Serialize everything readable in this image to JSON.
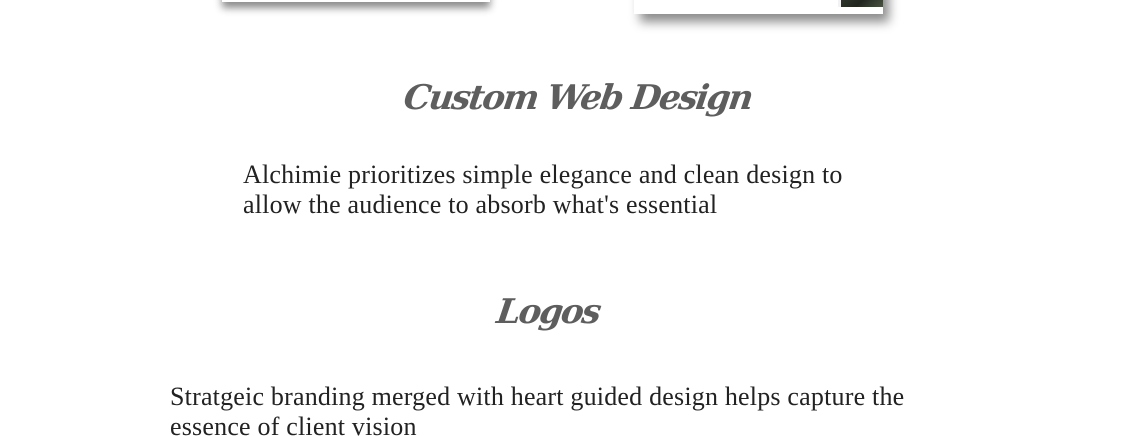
{
  "sections": [
    {
      "title": "Custom Web Design",
      "description": "Alchimie prioritizes simple elegance and clean design to allow the audience to absorb what's essential"
    },
    {
      "title": "Logos",
      "description": "Stratgeic branding merged with heart guided design helps capture the essence of client vision"
    }
  ],
  "colors": {
    "heading": "#5e5e5e",
    "body_text": "#222222",
    "background": "#ffffff"
  }
}
